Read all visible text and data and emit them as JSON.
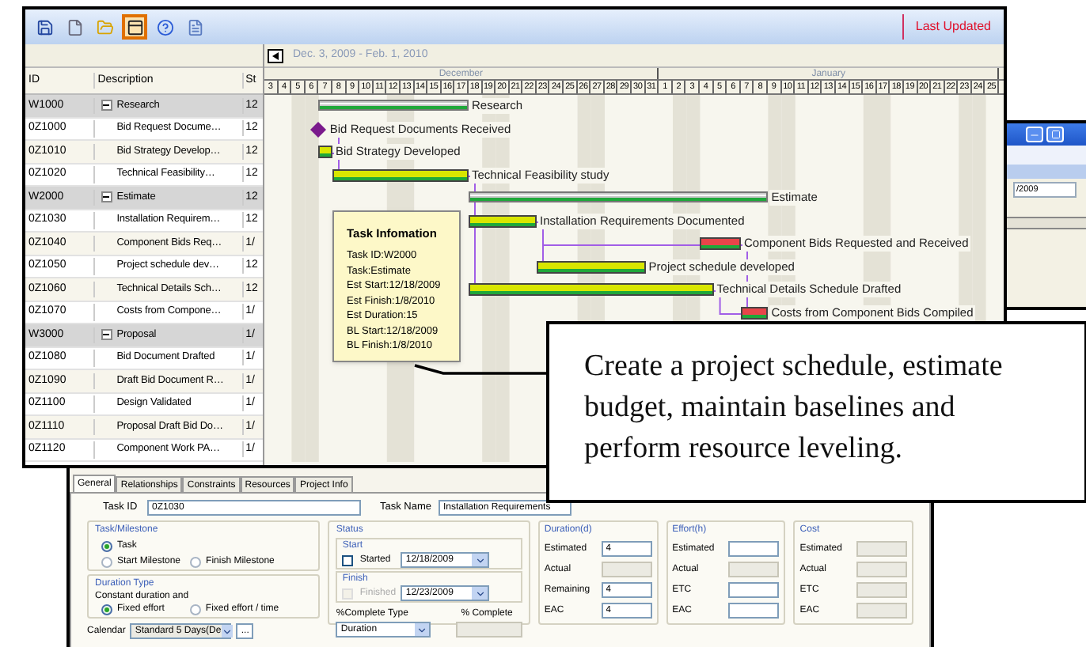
{
  "main_window": {
    "toolbar": {
      "buttons": [
        {
          "kind": "save",
          "selected": false
        },
        {
          "kind": "new",
          "selected": false
        },
        {
          "kind": "open",
          "selected": false
        },
        {
          "kind": "window",
          "selected": true
        },
        {
          "kind": "help",
          "selected": false
        },
        {
          "kind": "list",
          "selected": false
        }
      ],
      "last_updated": "Last Updated"
    },
    "table": {
      "columns": [
        "ID",
        "Description",
        "St"
      ],
      "rows": [
        {
          "id": "W1000",
          "description": "Research",
          "start": "12",
          "kind": "summary",
          "expanded": true
        },
        {
          "id": "0Z1000",
          "description": "Bid Request Docume…",
          "start": "12",
          "kind": "task"
        },
        {
          "id": "0Z1010",
          "description": "Bid Strategy Develop…",
          "start": "12",
          "kind": "task"
        },
        {
          "id": "0Z1020",
          "description": "Technical Feasibility…",
          "start": "12",
          "kind": "task"
        },
        {
          "id": "W2000",
          "description": "Estimate",
          "start": "12",
          "kind": "summary",
          "expanded": true
        },
        {
          "id": "0Z1030",
          "description": "Installation Requirem…",
          "start": "12",
          "kind": "task"
        },
        {
          "id": "0Z1040",
          "description": "Component Bids Req…",
          "start": "1/",
          "kind": "task"
        },
        {
          "id": "0Z1050",
          "description": "Project schedule dev…",
          "start": "12",
          "kind": "task"
        },
        {
          "id": "0Z1060",
          "description": "Technical Details Sch…",
          "start": "12",
          "kind": "task"
        },
        {
          "id": "0Z1070",
          "description": "Costs from Compone…",
          "start": "1/",
          "kind": "task"
        },
        {
          "id": "W3000",
          "description": "Proposal",
          "start": "1/",
          "kind": "summary",
          "expanded": true
        },
        {
          "id": "0Z1080",
          "description": "Bid Document Drafted",
          "start": "1/",
          "kind": "task"
        },
        {
          "id": "0Z1090",
          "description": "Draft Bid Document R…",
          "start": "1/",
          "kind": "task"
        },
        {
          "id": "0Z1100",
          "description": "Design Validated",
          "start": "1/",
          "kind": "task"
        },
        {
          "id": "0Z1110",
          "description": "Proposal Draft Bid Do…",
          "start": "1/",
          "kind": "task"
        },
        {
          "id": "0Z1120",
          "description": "Component Work PA…",
          "start": "1/",
          "kind": "task"
        }
      ]
    },
    "gantt": {
      "range": "Dec. 3, 2009 - Feb. 1, 2010",
      "months": [
        {
          "name": "December",
          "days": [
            "3",
            "4",
            "5",
            "6",
            "7",
            "8",
            "9",
            "10",
            "11",
            "12",
            "13",
            "14",
            "15",
            "16",
            "17",
            "18",
            "19",
            "20",
            "21",
            "22",
            "23",
            "24",
            "25",
            "26",
            "27",
            "28",
            "29",
            "30",
            "31"
          ]
        },
        {
          "name": "January",
          "days": [
            "1",
            "2",
            "3",
            "4",
            "5",
            "6",
            "7",
            "8",
            "9",
            "10",
            "11",
            "12",
            "13",
            "14",
            "15",
            "16",
            "17",
            "18",
            "19",
            "20",
            "21",
            "22",
            "23",
            "24",
            "25"
          ]
        }
      ],
      "bars": [
        {
          "kind": "summary",
          "label": "Research"
        },
        {
          "kind": "milestone",
          "label": "Bid Request Documents Received"
        },
        {
          "kind": "task",
          "label": "Bid Strategy Developed",
          "color": "#d8e600"
        },
        {
          "kind": "task",
          "label": "Technical Feasibility study",
          "color": "#d8e600"
        },
        {
          "kind": "summary",
          "label": "Estimate"
        },
        {
          "kind": "task",
          "label": "Installation Requirements Documented",
          "color": "#d8e600"
        },
        {
          "kind": "task",
          "label": "Component Bids Requested and Received",
          "color": "#e8454a"
        },
        {
          "kind": "task",
          "label": "Project schedule developed",
          "color": "#d8e600"
        },
        {
          "kind": "task",
          "label": "Technical Details Schedule Drafted",
          "color": "#d8e600"
        },
        {
          "kind": "task",
          "label": "Costs from Component Bids Compiled",
          "color": "#e8454a"
        }
      ]
    },
    "tooltip": {
      "title": "Task Infomation",
      "lines": [
        "Task ID:W2000",
        "Task:Estimate",
        "Est Start:12/18/2009",
        "Est Finish:1/8/2010",
        "Est Duration:15",
        "BL Start:12/18/2009",
        "BL Finish:1/8/2010"
      ]
    }
  },
  "side_window": {
    "field": "/2009"
  },
  "task_form": {
    "tabs": [
      {
        "label": "General",
        "selected": true
      },
      {
        "label": "Relationships",
        "selected": false
      },
      {
        "label": "Constraints",
        "selected": false
      },
      {
        "label": "Resources",
        "selected": false
      },
      {
        "label": "Project Info",
        "selected": false
      }
    ],
    "task_id": {
      "label": "Task ID",
      "value": "0Z1030"
    },
    "task_name": {
      "label": "Task Name",
      "value": "Installation Requirements"
    },
    "task_milestone": {
      "title": "Task/Milestone",
      "options": [
        {
          "label": "Task",
          "selected": true
        },
        {
          "label": "Start Milestone",
          "selected": false
        },
        {
          "label": "Finish Milestone",
          "selected": false
        }
      ]
    },
    "duration_type": {
      "title": "Duration Type",
      "caption": "Constant duration and",
      "options": [
        {
          "label": "Fixed effort",
          "selected": true
        },
        {
          "label": "Fixed effort / time",
          "selected": false
        }
      ]
    },
    "calendar": {
      "label": "Calendar",
      "value": "Standard 5 Days(De",
      "more": "..."
    },
    "status": {
      "title": "Status",
      "start": {
        "title": "Start",
        "checkbox": "Started",
        "checked": false,
        "disabled": false,
        "date": "12/18/2009"
      },
      "finish": {
        "title": "Finish",
        "checkbox": "Finished",
        "checked": false,
        "disabled": true,
        "date": "12/23/2009"
      },
      "complete_type": {
        "label": "%Complete Type",
        "value": "Duration"
      },
      "complete": {
        "label": "% Complete",
        "disabled": true
      }
    },
    "groups": [
      {
        "title": "Duration(d)",
        "fields": [
          {
            "label": "Estimated",
            "value": "4",
            "disabled": false
          },
          {
            "label": "Actual",
            "disabled": true
          },
          {
            "label": "Remaining",
            "value": "4",
            "disabled": false
          },
          {
            "label": "EAC",
            "value": "4",
            "disabled": false
          }
        ]
      },
      {
        "title": "Effort(h)",
        "fields": [
          {
            "label": "Estimated",
            "disabled": false
          },
          {
            "label": "Actual",
            "disabled": true
          },
          {
            "label": "ETC",
            "disabled": false
          },
          {
            "label": "EAC",
            "disabled": false
          }
        ]
      },
      {
        "title": "Cost",
        "fields": [
          {
            "label": "Estimated",
            "disabled": true
          },
          {
            "label": "Actual",
            "disabled": true
          },
          {
            "label": "ETC",
            "disabled": true
          },
          {
            "label": "EAC",
            "disabled": true
          }
        ]
      }
    ]
  },
  "callout": {
    "text": "Create a project schedule, estimate budget, maintain baselines and perform resource leveling."
  }
}
